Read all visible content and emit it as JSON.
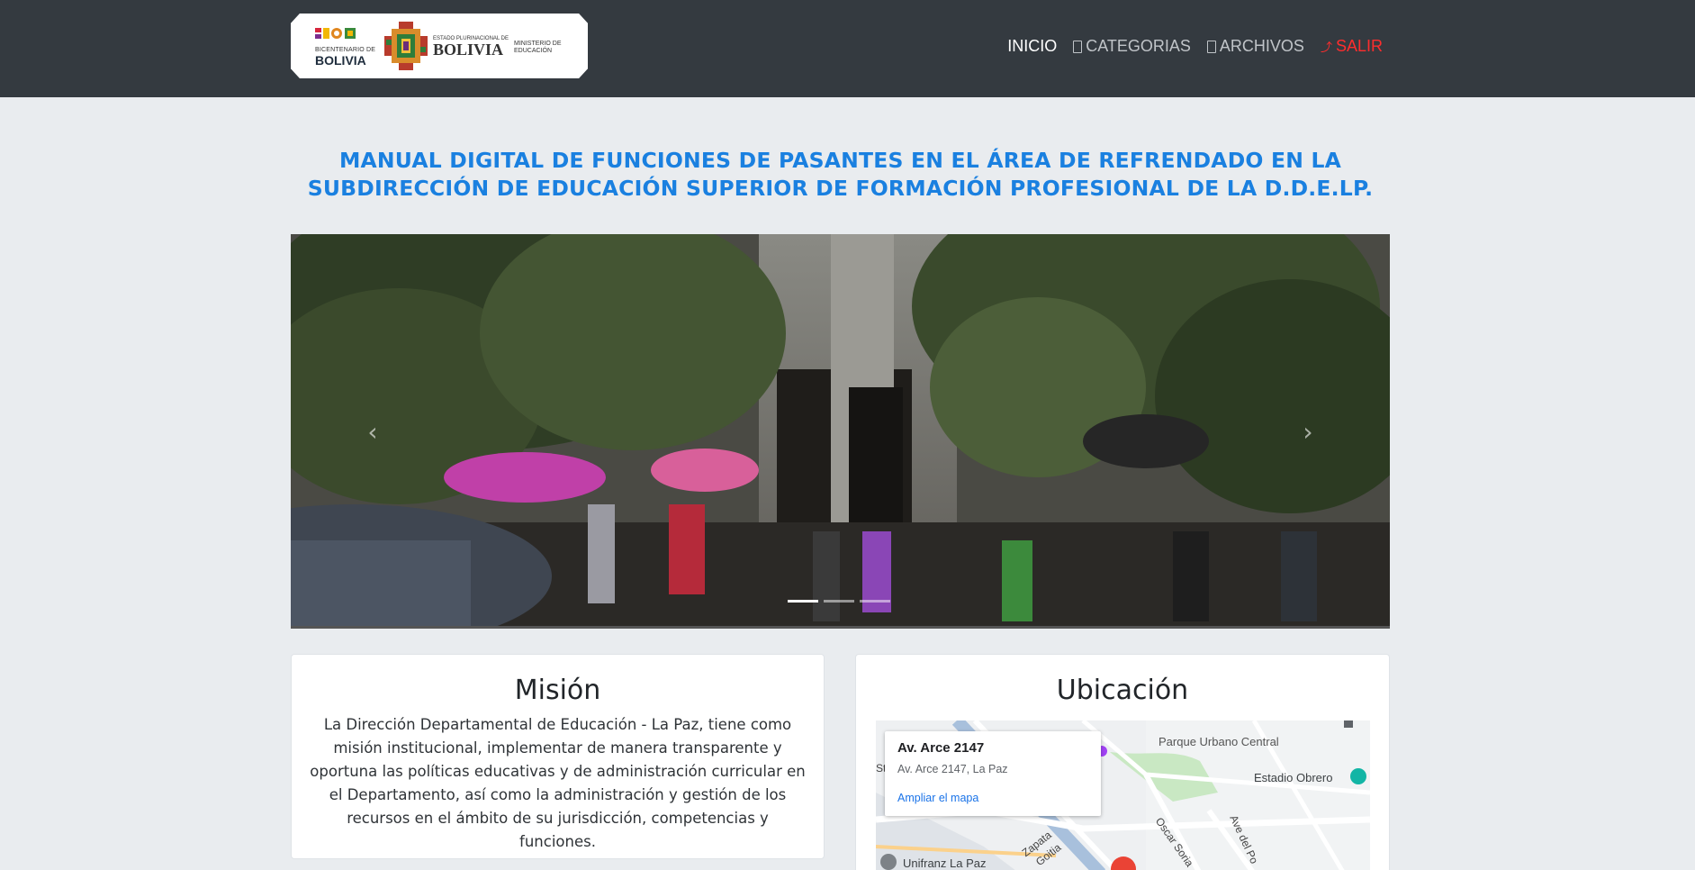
{
  "header": {
    "logo": {
      "bicentenario_line1": "BICENTENARIO DE",
      "bicentenario_line2": "BOLIVIA",
      "estado_line1": "ESTADO PLURINACIONAL DE",
      "estado_line2": "BOLIVIA",
      "ministerio": "MINISTERIO DE EDUCACIÓN"
    },
    "nav": [
      {
        "label": "INICIO",
        "icon": "",
        "active": true
      },
      {
        "label": "CATEGORIAS",
        "icon": "folder-icon"
      },
      {
        "label": "ARCHIVOS",
        "icon": "file-icon"
      },
      {
        "label": "SALIR",
        "icon": "exit-icon"
      }
    ]
  },
  "page": {
    "title_line1": "MANUAL DIGITAL DE FUNCIONES DE PASANTES EN EL ÁREA DE REFRENDADO EN LA",
    "title_line2": "SUBDIRECCIÓN DE EDUCACIÓN SUPERIOR DE FORMACIÓN PROFESIONAL DE LA D.D.E.LP.",
    "title_color": "#1a80e0"
  },
  "carousel": {
    "prev_symbol": "‹",
    "next_symbol": "›",
    "slides_count": 3,
    "active_slide": 1
  },
  "mision": {
    "title": "Misión",
    "text": "La Dirección Departamental de Educación - La Paz, tiene como misión institucional, implementar de manera transparente y oportuna las políticas educativas y de administración curricular en el Departamento, así como la administración y gestión de los recursos en el ámbito de su jurisdicción, competencias y funciones."
  },
  "ubicacion": {
    "title": "Ubicación",
    "map": {
      "place_title": "Av. Arce 2147",
      "place_address": "Av. Arce 2147, La Paz",
      "link": "Ampliar el mapa",
      "labels": {
        "park": "Parque Urbano Central",
        "stadium": "Estadio Obrero",
        "unifranz": "Unifranz La Paz",
        "zapata": "Zapata",
        "goitia": "Goitia",
        "oscar": "Oscar Soria",
        "ave_del": "Ave del Po",
        "st": "St"
      }
    }
  }
}
